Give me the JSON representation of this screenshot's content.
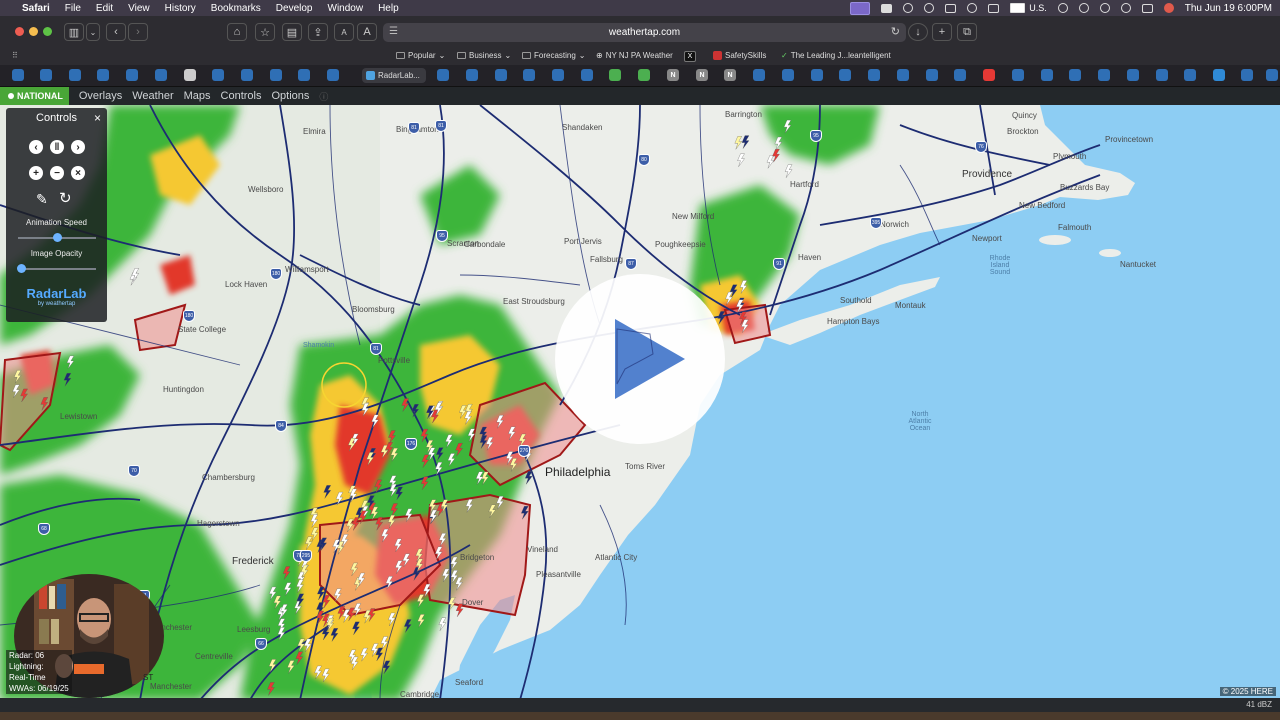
{
  "menubar": {
    "app": "Safari",
    "items": [
      "File",
      "Edit",
      "View",
      "History",
      "Bookmarks",
      "Develop",
      "Window",
      "Help"
    ],
    "input_source": "U.S.",
    "clock": "Thu Jun 19  6:00PM"
  },
  "toolbar": {
    "url": "weathertap.com",
    "font_small": "A",
    "font_large": "A"
  },
  "favorites": [
    {
      "label": "Popular",
      "has_menu": true
    },
    {
      "label": "Business",
      "has_menu": true
    },
    {
      "label": "Forecasting",
      "has_menu": true
    },
    {
      "label": "NY NJ PA Weather",
      "has_menu": false
    },
    {
      "label": "X",
      "has_menu": false
    },
    {
      "label": "SafetySkills",
      "has_menu": false
    },
    {
      "label": "The Leading J...leantelligent",
      "has_menu": false
    }
  ],
  "tabs": {
    "active_label": "RadarLab...",
    "letters": [
      "N",
      "N",
      "N"
    ]
  },
  "appnav": {
    "national": "NATIONAL",
    "items": [
      "Overlays",
      "Weather",
      "Maps",
      "Controls",
      "Options"
    ]
  },
  "controls": {
    "title": "Controls",
    "close": "×",
    "animation_speed_label": "Animation Speed",
    "animation_speed": 0.5,
    "image_opacity_label": "Image Opacity",
    "image_opacity": 0.05,
    "logo": "RadarLab",
    "logo_sub": "by weathertap"
  },
  "map": {
    "labels": [
      {
        "t": "Elmira"
      },
      {
        "t": "Binghamton"
      },
      {
        "t": "Shandaken"
      },
      {
        "t": "Barrington"
      },
      {
        "t": "Quincy"
      },
      {
        "t": "Brockton"
      },
      {
        "t": "Provincetown"
      },
      {
        "t": "Plymouth"
      },
      {
        "t": "Providence"
      },
      {
        "t": "Buzzards Bay"
      },
      {
        "t": "New Bedford"
      },
      {
        "t": "Falmouth"
      },
      {
        "t": "Newport"
      },
      {
        "t": "Rhode Island Sound"
      },
      {
        "t": "Nantucket"
      },
      {
        "t": "Hartford"
      },
      {
        "t": "Norwich"
      },
      {
        "t": "Haven"
      },
      {
        "t": "Southold"
      },
      {
        "t": "Montauk"
      },
      {
        "t": "Hampton Bays"
      },
      {
        "t": "Wellsboro"
      },
      {
        "t": "Fallsburg"
      },
      {
        "t": "Poughkeepsie"
      },
      {
        "t": "New Milford"
      },
      {
        "t": "Carbondale"
      },
      {
        "t": "Scranton"
      },
      {
        "t": "Port Jervis"
      },
      {
        "t": "Williamsport"
      },
      {
        "t": "Lock Haven"
      },
      {
        "t": "Bloomsburg"
      },
      {
        "t": "East Stroudsburg"
      },
      {
        "t": "State College"
      },
      {
        "t": "Shamokin"
      },
      {
        "t": "Pottsville"
      },
      {
        "t": "Huntingdon"
      },
      {
        "t": "Lewistown"
      },
      {
        "t": "Chambersburg"
      },
      {
        "t": "Hagerstown"
      },
      {
        "t": "Frederick"
      },
      {
        "t": "Philadelphia"
      },
      {
        "t": "Toms River"
      },
      {
        "t": "Bridgeton"
      },
      {
        "t": "Vineland"
      },
      {
        "t": "Pleasantville"
      },
      {
        "t": "Atlantic City"
      },
      {
        "t": "Dover"
      },
      {
        "t": "Leesburg"
      },
      {
        "t": "Centreville"
      },
      {
        "t": "Winchester"
      },
      {
        "t": "Seaford"
      },
      {
        "t": "Cambridge"
      },
      {
        "t": "Harrisonburg"
      },
      {
        "t": "Manchester"
      }
    ],
    "ocean_label": "North Atlantic Ocean",
    "shields": [
      "81",
      "80",
      "180",
      "81",
      "180",
      "87",
      "84",
      "87",
      "91",
      "395",
      "95",
      "176",
      "276",
      "78",
      "70",
      "81",
      "68",
      "76",
      "95",
      "81",
      "66",
      "295"
    ],
    "copyright": "© 2025 HERE"
  },
  "legend": {
    "radar": "Radar: 06",
    "lightning": "Lightning:",
    "realtime": "Real-Time",
    "wwas": "WWAs: 06/19/25",
    "tz": "ST"
  },
  "footer": {
    "dbz": "41 dBZ"
  },
  "colors": {
    "accent": "#49a637",
    "water": "#8dcdf3",
    "land": "#eceeea",
    "roads": "#1d2c72",
    "radar_light": "#3db53a",
    "radar_mid": "#f5c830",
    "radar_heavy": "#e2382a",
    "warning_fill": "#f08c8c",
    "warning_stroke": "#a01818"
  }
}
